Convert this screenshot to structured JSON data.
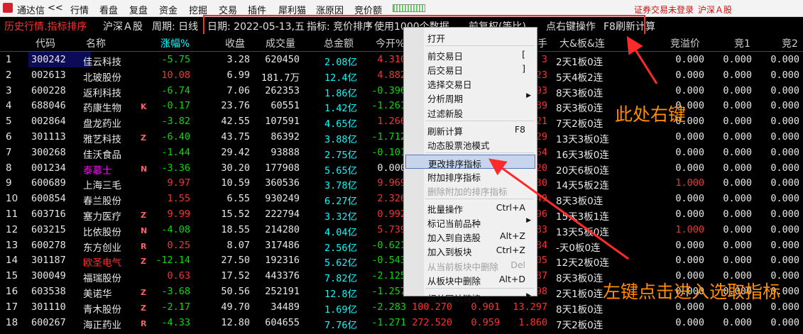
{
  "menubar": {
    "app_title": "通达信",
    "nav": "<<",
    "items": [
      "行情",
      "看盘",
      "复盘",
      "资金",
      "挖掘",
      "交易",
      "插件",
      "犀利猫",
      "涨原因",
      "竞价额"
    ],
    "login_status": "证券交易未登录",
    "market": "沪深Ａ股"
  },
  "title_bar": {
    "mode": "历史行情.指标排序",
    "market": "沪深Ａ股",
    "period": "周期: 日线",
    "date": "日期: 2022-05-13,五",
    "indicator": "指标: 竞价排序",
    "info": "使用1000个数据",
    "adjust": "前复权(等比)",
    "hint": "点右键操作",
    "refresh": "F8刷新计算"
  },
  "columns": [
    "代码",
    "名称",
    "涨幅%",
    "收盘",
    "成交量",
    "总金额",
    "今开%",
    "手",
    "大&板&连",
    "竞溢价",
    "竞1",
    "竞2"
  ],
  "rows": [
    {
      "no": "1",
      "code": "300242",
      "name": "佳云科技",
      "flag": "",
      "chg": "-5.75",
      "close": "3.28",
      "vol": "620450",
      "amt": "2.08亿",
      "open": "4.310",
      "e1": "",
      "e2": "",
      "e3": "3",
      "lb": "2天1板0连",
      "jy": "0.000",
      "j1": "0.000",
      "j2": "0.000"
    },
    {
      "no": "2",
      "code": "002613",
      "name": "北玻股份",
      "flag": "",
      "chg": "10.08",
      "close": "6.99",
      "vol": "181.7万",
      "amt": "12.4亿",
      "open": "4.882",
      "e1": "",
      "e2": "",
      "e3": "23",
      "lb": "5天4板2连",
      "jy": "0.000",
      "j1": "0.000",
      "j2": "0.000"
    },
    {
      "no": "3",
      "code": "600228",
      "name": "返利科技",
      "flag": "",
      "chg": "-6.74",
      "close": "7.06",
      "vol": "262353",
      "amt": "1.86亿",
      "open": "-0.396",
      "e1": "",
      "e2": "",
      "e3": "93",
      "lb": "8天3板0连",
      "jy": "0.000",
      "j1": "0.000",
      "j2": "0.000"
    },
    {
      "no": "4",
      "code": "688046",
      "name": "药康生物",
      "flag": "K",
      "chg": "-0.17",
      "close": "23.76",
      "vol": "60551",
      "amt": "1.42亿",
      "open": "-1.261",
      "e1": "",
      "e2": "",
      "e3": "89",
      "lb": "8天3板0连",
      "jy": "0.000",
      "j1": "0.000",
      "j2": "0.000"
    },
    {
      "no": "5",
      "code": "002864",
      "name": "盘龙药业",
      "flag": "",
      "chg": "-3.82",
      "close": "42.55",
      "vol": "107591",
      "amt": "4.65亿",
      "open": "1.266",
      "e1": "",
      "e2": "",
      "e3": "21",
      "lb": "7天2板0连",
      "jy": "0.000",
      "j1": "0.000",
      "j2": "0.000"
    },
    {
      "no": "6",
      "code": "301113",
      "name": "雅艺科技",
      "flag": "Z",
      "chg": "-6.40",
      "close": "43.75",
      "vol": "86392",
      "amt": "3.88亿",
      "open": "-1.712",
      "e1": "",
      "e2": "",
      "e3": "29",
      "lb": "13天3板0连",
      "jy": "0.000",
      "j1": "0.000",
      "j2": "0.000"
    },
    {
      "no": "7",
      "code": "300268",
      "name": "佳沃食品",
      "flag": "",
      "chg": "-1.44",
      "close": "29.42",
      "vol": "93888",
      "amt": "2.75亿",
      "open": "-0.101",
      "e1": "",
      "e2": "",
      "e3": "64",
      "lb": "16天3板0连",
      "jy": "0.000",
      "j1": "0.000",
      "j2": "0.000"
    },
    {
      "no": "8",
      "code": "001234",
      "name": "泰慕士",
      "flag": "N",
      "chg": "-3.36",
      "close": "30.20",
      "vol": "177908",
      "amt": "5.65亿",
      "open": "0.000",
      "e1": "",
      "e2": "",
      "e3": "20",
      "lb": "20天6板0连",
      "jy": "0.000",
      "j1": "0.000",
      "j2": "0.000"
    },
    {
      "no": "9",
      "code": "600689",
      "name": "上海三毛",
      "flag": "",
      "chg": "9.97",
      "close": "10.59",
      "vol": "360536",
      "amt": "3.78亿",
      "open": "9.969",
      "e1": "",
      "e2": "",
      "e3": "30",
      "lb": "14天5板2连",
      "jy": "1.000",
      "j1": "0.000",
      "j2": "0.000"
    },
    {
      "no": "10",
      "code": "600854",
      "name": "春兰股份",
      "flag": "",
      "chg": "1.55",
      "close": "6.55",
      "vol": "930249",
      "amt": "6.27亿",
      "open": "2.326",
      "e1": "",
      "e2": "",
      "e3": "49",
      "lb": "8天3板0连",
      "jy": "0.000",
      "j1": "0.000",
      "j2": "0.000"
    },
    {
      "no": "11",
      "code": "603716",
      "name": "塞力医疗",
      "flag": "Z",
      "chg": "9.99",
      "close": "15.52",
      "vol": "222794",
      "amt": "3.32亿",
      "open": "0.992",
      "e1": "",
      "e2": "",
      "e3": "96",
      "lb": "15天3板1连",
      "jy": "0.000",
      "j1": "0.000",
      "j2": "0.000"
    },
    {
      "no": "12",
      "code": "603215",
      "name": "比依股份",
      "flag": "N",
      "chg": "-4.08",
      "close": "18.55",
      "vol": "214280",
      "amt": "4.04亿",
      "open": "5.739",
      "e1": "",
      "e2": "",
      "e3": "83",
      "lb": "13天5板0连",
      "jy": "1.000",
      "j1": "0.000",
      "j2": "0.000"
    },
    {
      "no": "13",
      "code": "600278",
      "name": "东方创业",
      "flag": "R",
      "chg": "0.25",
      "close": "8.07",
      "vol": "317486",
      "amt": "2.56亿",
      "open": "-0.621",
      "e1": "",
      "e2": "",
      "e3": "84",
      "lb": "-天0板0连",
      "jy": "0.000",
      "j1": "0.000",
      "j2": "0.000"
    },
    {
      "no": "14",
      "code": "301187",
      "name": "欧圣电气",
      "flag": "Z",
      "chg": "-12.14",
      "close": "27.50",
      "vol": "192316",
      "amt": "5.62亿",
      "open": "-0.543",
      "e1": "",
      "e2": "",
      "e3": "05",
      "lb": "12天2板0连",
      "jy": "0.000",
      "j1": "0.000",
      "j2": "0.000"
    },
    {
      "no": "15",
      "code": "300049",
      "name": "福瑞股份",
      "flag": "",
      "chg": "0.63",
      "close": "17.52",
      "vol": "443376",
      "amt": "7.82亿",
      "open": "-2.125",
      "e1": "",
      "e2": "",
      "e3": "87",
      "lb": "8天3板0连",
      "jy": "0.000",
      "j1": "0.000",
      "j2": "0.000"
    },
    {
      "no": "16",
      "code": "603538",
      "name": "美诺华",
      "flag": "Z",
      "chg": "-3.68",
      "close": "50.56",
      "vol": "252191",
      "amt": "12.8亿",
      "open": "-1.257",
      "e1": "",
      "e2": "",
      "e3": "98",
      "lb": "2天1板0连",
      "jy": "0.000",
      "j1": "0.000",
      "j2": "0.000"
    },
    {
      "no": "17",
      "code": "301110",
      "name": "青木股份",
      "flag": "Z",
      "chg": "-2.17",
      "close": "49.70",
      "vol": "34489",
      "amt": "1.69亿",
      "open": "-2.283",
      "e1": "100.270",
      "e2": "0.901",
      "e3": "13.297",
      "lb": "8天1板0连",
      "jy": "0.000",
      "j1": "0.000",
      "j2": "0.000"
    },
    {
      "no": "18",
      "code": "600267",
      "name": "海正药业",
      "flag": "R",
      "chg": "-4.33",
      "close": "12.80",
      "vol": "604655",
      "amt": "7.76亿",
      "open": "-1.271",
      "e1": "272.520",
      "e2": "0.959",
      "e3": "1.860",
      "lb": "7天2板0连",
      "jy": "0.000",
      "j1": "0.000",
      "j2": "0.000"
    }
  ],
  "context_menu": {
    "items": [
      {
        "label": "打开",
        "shortcut": "",
        "submenu": false,
        "disabled": false,
        "selected": false
      },
      {
        "sep": true
      },
      {
        "label": "前交易日",
        "shortcut": "[",
        "submenu": false,
        "disabled": false,
        "selected": false
      },
      {
        "label": "后交易日",
        "shortcut": "]",
        "submenu": false,
        "disabled": false,
        "selected": false
      },
      {
        "label": "选择交易日",
        "shortcut": "",
        "submenu": false,
        "disabled": false,
        "selected": false
      },
      {
        "label": "分析周期",
        "shortcut": "",
        "submenu": true,
        "disabled": false,
        "selected": false
      },
      {
        "label": "过滤新股",
        "shortcut": "",
        "submenu": false,
        "disabled": false,
        "selected": false
      },
      {
        "sep": true
      },
      {
        "label": "刷新计算",
        "shortcut": "F8",
        "submenu": false,
        "disabled": false,
        "selected": false
      },
      {
        "label": "动态股票池模式",
        "shortcut": "",
        "submenu": false,
        "disabled": false,
        "selected": false
      },
      {
        "sep": true
      },
      {
        "label": "更改排序指标",
        "shortcut": "",
        "submenu": false,
        "disabled": false,
        "selected": true
      },
      {
        "label": "附加排序指标",
        "shortcut": "",
        "submenu": false,
        "disabled": false,
        "selected": false
      },
      {
        "label": "删除附加的排序指标",
        "shortcut": "",
        "submenu": false,
        "disabled": true,
        "selected": false
      },
      {
        "sep": true
      },
      {
        "label": "批量操作",
        "shortcut": "Ctrl+A",
        "submenu": false,
        "disabled": false,
        "selected": false
      },
      {
        "label": "标记当前品种",
        "shortcut": "",
        "submenu": true,
        "disabled": false,
        "selected": false
      },
      {
        "label": "加入到自选股",
        "shortcut": "Alt+Z",
        "submenu": false,
        "disabled": false,
        "selected": false
      },
      {
        "label": "加入到板块",
        "shortcut": "Ctrl+Z",
        "submenu": false,
        "disabled": false,
        "selected": false
      },
      {
        "label": "从当前板块中删除",
        "shortcut": "Del",
        "submenu": false,
        "disabled": true,
        "selected": false
      },
      {
        "label": "从板块中删除",
        "shortcut": "Alt+D",
        "submenu": false,
        "disabled": false,
        "selected": false
      },
      {
        "sep": true
      },
      {
        "label": "相关网站链接",
        "shortcut": "",
        "submenu": true,
        "disabled": false,
        "selected": false
      }
    ]
  },
  "annotations": {
    "right_click": "此处右键",
    "left_click": "左键点击进入选取指标"
  },
  "colors": {
    "up": "#ff3030",
    "down": "#00e000",
    "accent": "#00ffff",
    "name": "#e8e8e8",
    "annotation": "#ff8c00",
    "box": "#ff2a2a"
  }
}
